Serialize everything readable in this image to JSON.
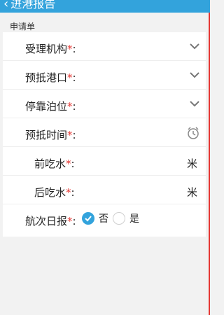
{
  "header": {
    "back_icon": "chevron-left-icon",
    "title": "进港报告"
  },
  "section": {
    "label": "申请单"
  },
  "rows": [
    {
      "label": "受理机构",
      "required": "*",
      "colon": ":",
      "icon": "chevron-down-icon"
    },
    {
      "label": "预抵港口",
      "required": "*",
      "colon": ":",
      "icon": "chevron-down-icon"
    },
    {
      "label": "停靠泊位",
      "required": "*",
      "colon": ":",
      "icon": "chevron-down-icon"
    },
    {
      "label": "预抵时间",
      "required": "*",
      "colon": ":",
      "icon": "alarm-clock-icon"
    },
    {
      "label": "前吃水",
      "required": "*",
      "colon": ":",
      "unit": "米"
    },
    {
      "label": "后吃水",
      "required": "*",
      "colon": ":",
      "unit": "米"
    },
    {
      "label": "航次日报",
      "required": "*",
      "colon": ":",
      "options": [
        "否",
        "是"
      ],
      "selected": "否"
    }
  ],
  "colors": {
    "accent": "#33a3dc",
    "required": "#e53935"
  }
}
